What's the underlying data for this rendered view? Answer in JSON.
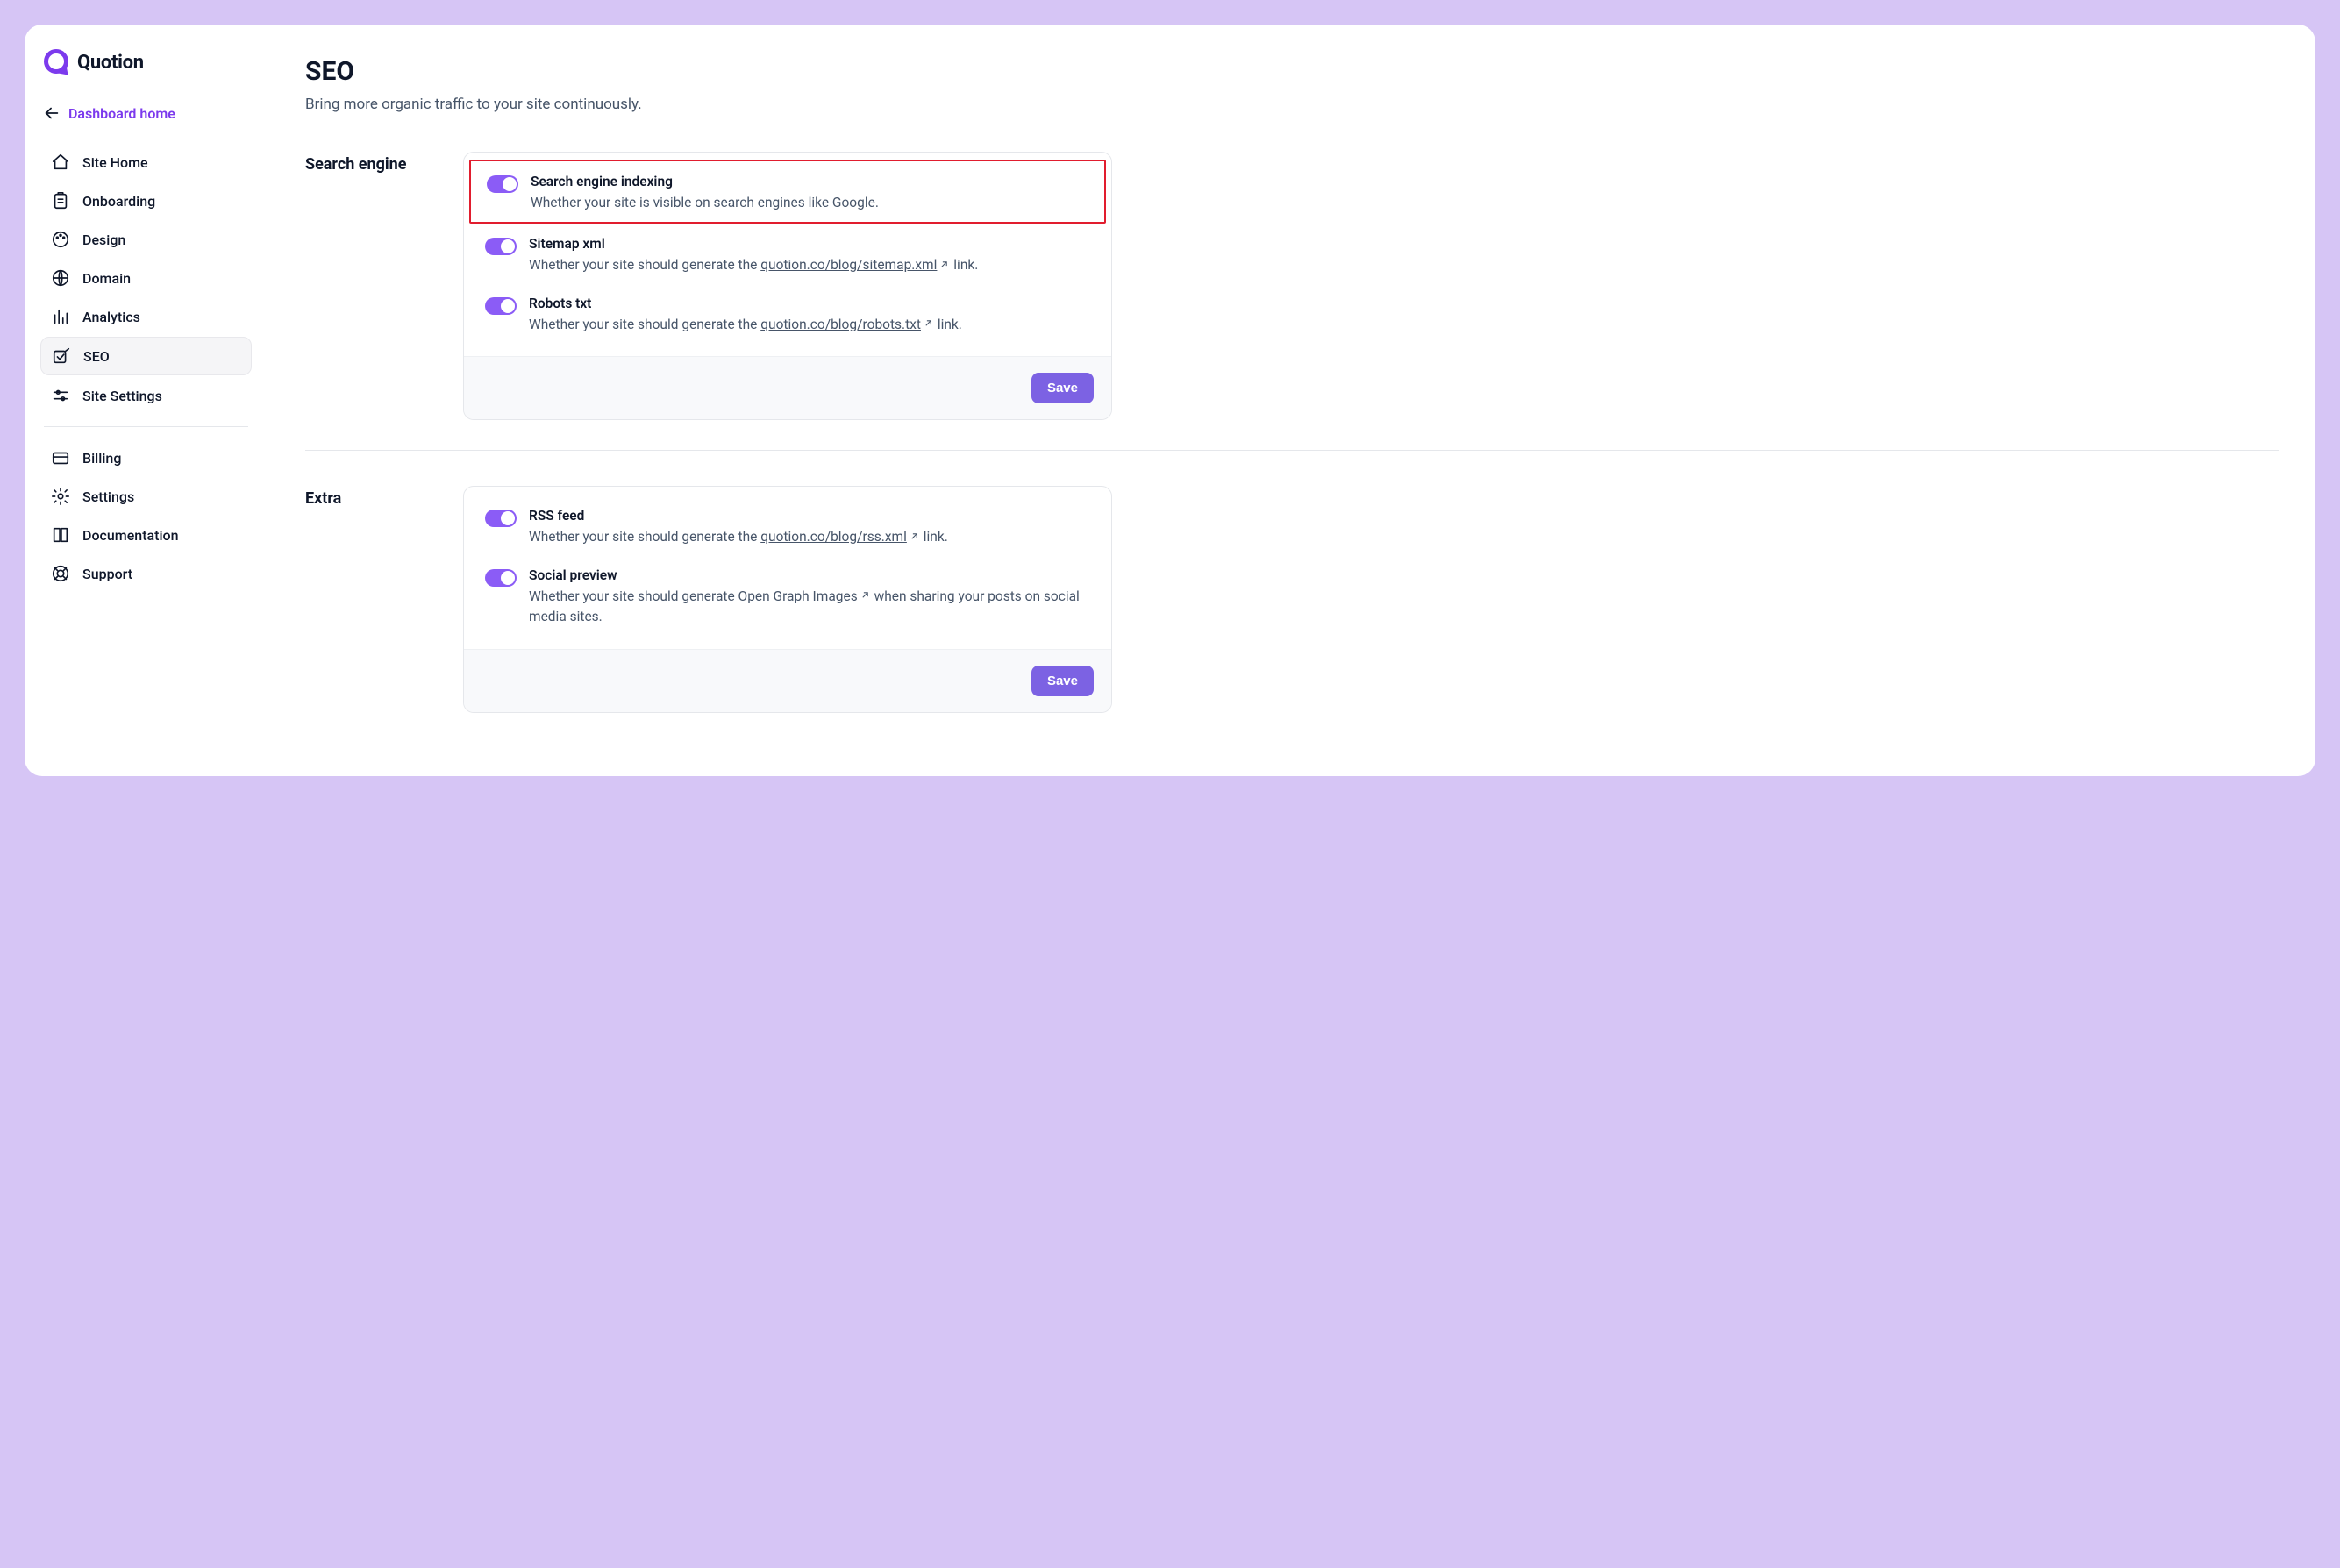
{
  "brand": {
    "name": "Quotion"
  },
  "sidebar": {
    "back_label": "Dashboard home",
    "items": [
      {
        "id": "site-home",
        "label": "Site Home"
      },
      {
        "id": "onboarding",
        "label": "Onboarding"
      },
      {
        "id": "design",
        "label": "Design"
      },
      {
        "id": "domain",
        "label": "Domain"
      },
      {
        "id": "analytics",
        "label": "Analytics"
      },
      {
        "id": "seo",
        "label": "SEO",
        "active": true
      },
      {
        "id": "site-settings",
        "label": "Site Settings"
      }
    ],
    "items2": [
      {
        "id": "billing",
        "label": "Billing"
      },
      {
        "id": "settings",
        "label": "Settings"
      },
      {
        "id": "documentation",
        "label": "Documentation"
      },
      {
        "id": "support",
        "label": "Support"
      }
    ]
  },
  "page": {
    "title": "SEO",
    "subtitle": "Bring more organic traffic to your site continuously."
  },
  "sections": {
    "search_engine": {
      "label": "Search engine",
      "save": "Save",
      "rows": [
        {
          "title": "Search engine indexing",
          "desc": "Whether your site is visible on search engines like Google.",
          "on": true,
          "highlighted": true
        },
        {
          "title": "Sitemap xml",
          "desc_pre": "Whether your site should generate the ",
          "link": "quotion.co/blog/sitemap.xml",
          "desc_post": " link.",
          "on": true
        },
        {
          "title": "Robots txt",
          "desc_pre": "Whether your site should generate the ",
          "link": "quotion.co/blog/robots.txt",
          "desc_post": " link.",
          "on": true
        }
      ]
    },
    "extra": {
      "label": "Extra",
      "save": "Save",
      "rows": [
        {
          "title": "RSS feed",
          "desc_pre": "Whether your site should generate the ",
          "link": "quotion.co/blog/rss.xml",
          "desc_post": " link.",
          "on": true
        },
        {
          "title": "Social preview",
          "desc_pre": "Whether your site should generate ",
          "link": "Open Graph Images",
          "desc_post": " when sharing your posts on social media sites.",
          "on": true
        }
      ]
    }
  }
}
